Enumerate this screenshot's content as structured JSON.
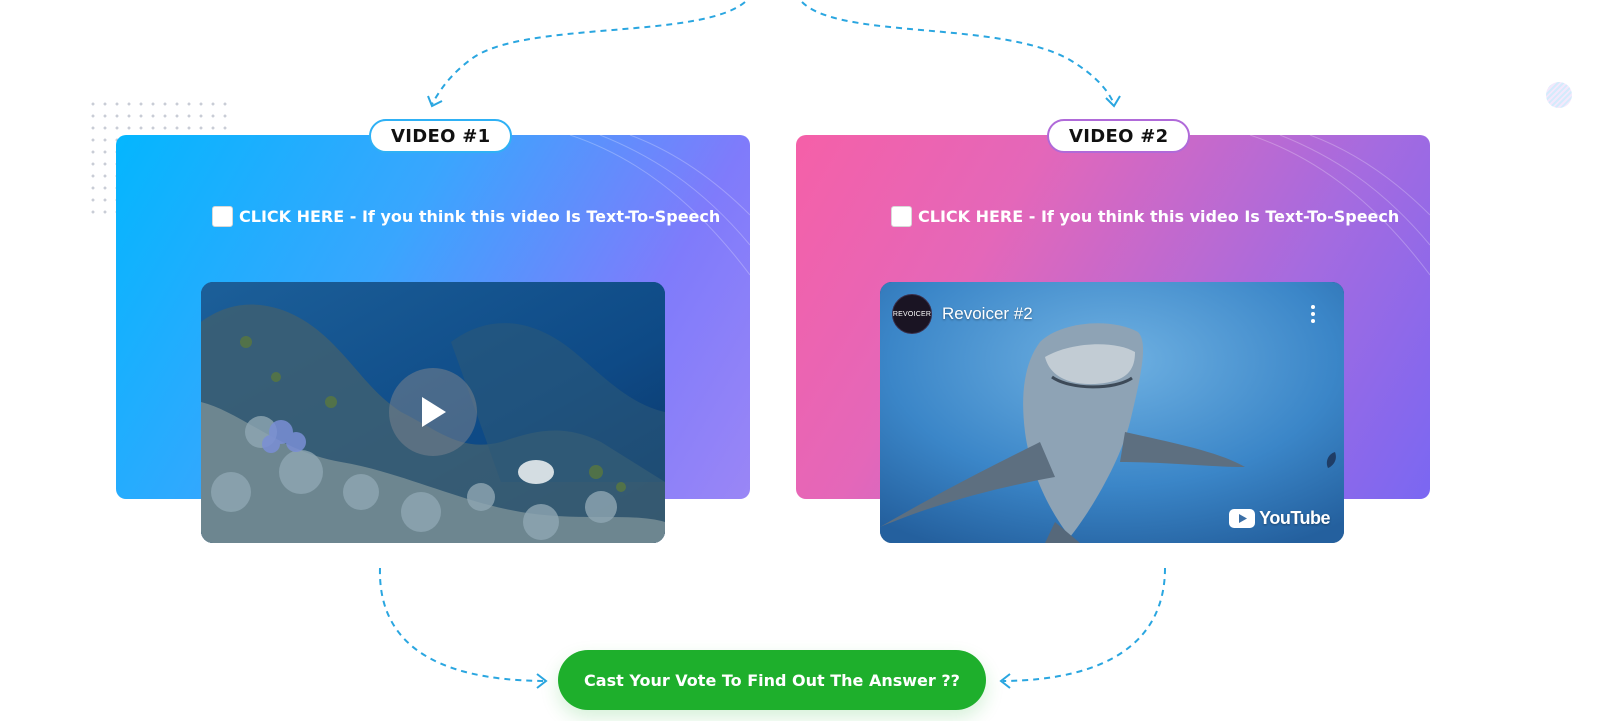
{
  "video1": {
    "badge": "VIDEO #1",
    "checkbox_label": "CLICK HERE - If you think this video Is Text-To-Speech"
  },
  "video2": {
    "badge": "VIDEO #2",
    "checkbox_label": "CLICK HERE - If you think this video Is Text-To-Speech",
    "channel_avatar_text": "REVOICER",
    "title": "Revoicer #2",
    "logo_text": "YouTube"
  },
  "vote_button": {
    "label": "Cast Your Vote To Find Out The Answer ??"
  },
  "colors": {
    "card1_start": "#04b6fe",
    "card1_end": "#9a86f6",
    "card2_start": "#f560a8",
    "card2_end": "#7a67f2",
    "arrow": "#2aa6e0",
    "vote_button": "#1eaf2c"
  },
  "icons": [
    "play-icon",
    "kebab-menu-icon",
    "youtube-logo-icon",
    "checkbox-icon",
    "dashed-arrow-icon"
  ]
}
